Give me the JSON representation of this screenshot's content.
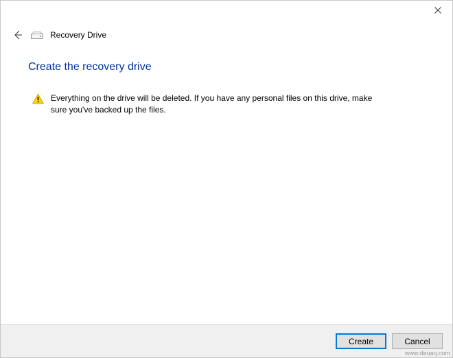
{
  "header": {
    "title": "Recovery Drive"
  },
  "page": {
    "title": "Create the recovery drive"
  },
  "warning": {
    "text": "Everything on the drive will be deleted. If you have any personal files on this drive, make sure you've backed up the files."
  },
  "buttons": {
    "create": "Create",
    "cancel": "Cancel"
  },
  "watermark": "www.deuaq.com"
}
